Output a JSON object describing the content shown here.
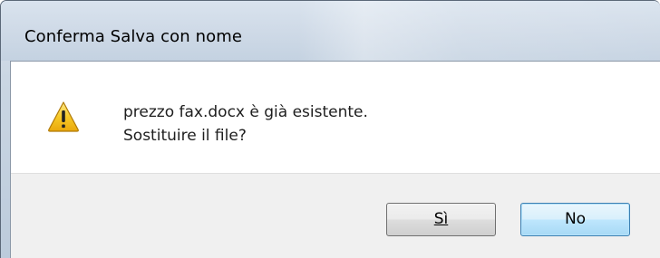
{
  "dialog": {
    "title": "Conferma Salva con nome",
    "icon": "warning-icon",
    "message_line1": "prezzo fax.docx è già esistente.",
    "message_line2": "Sostituire il file?"
  },
  "buttons": {
    "yes_label": "Sì",
    "no_label": "No"
  },
  "colors": {
    "warning_yellow": "#f5c518",
    "default_button_border": "#3c7fb1"
  }
}
